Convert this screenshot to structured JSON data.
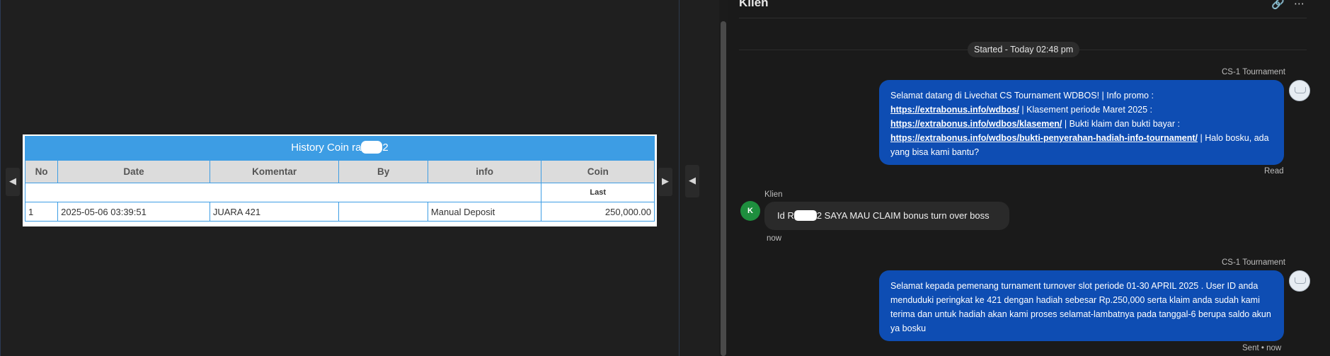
{
  "history": {
    "title_prefix": "History Coin ra",
    "title_suffix": "2",
    "columns": [
      "No",
      "Date",
      "Komentar",
      "By",
      "info",
      "Coin"
    ],
    "subheader": "Last",
    "rows": [
      {
        "no": "1",
        "date": "2025-05-06 03:39:51",
        "komentar": "JUARA 421",
        "by": "",
        "info": "Manual Deposit",
        "coin": "250,000.00"
      }
    ],
    "coin_color": "#2b8a2b",
    "accent": "#3d9de4"
  },
  "chat": {
    "title": "Klien",
    "started": "Started - Today 02:48 pm",
    "messages": [
      {
        "sender": "CS-1 Tournament",
        "parts": {
          "t1": "Selamat datang di Livechat CS Tournament WDBOS! | Info promo :",
          "l1": "https://extrabonus.info/wdbos/",
          "t2": " | Klasement periode Maret 2025 :",
          "l2": "https://extrabonus.info/wdbos/klasemen/",
          "t3": " | Bukti klaim dan bukti bayar :",
          "l3": "https://extrabonus.info/wdbos/bukti-penyerahan-hadiah-info-tournament/",
          "t4": " | Halo bosku, ada yang bisa kami bantu?"
        },
        "status": "Read"
      },
      {
        "sender": "Klien",
        "avatar": "K",
        "text_prefix": "Id R",
        "text_suffix": "2 SAYA MAU CLAIM bonus turn over boss",
        "time": "now"
      },
      {
        "sender": "CS-1 Tournament",
        "text": "Selamat kepada pemenang turnament turnover slot periode 01-30 APRIL 2025 . User ID anda menduduki peringkat ke 421 dengan hadiah sebesar Rp.250,000 serta klaim anda sudah kami terima dan untuk hadiah akan kami proses selamat-lambatnya pada tanggal-6 berupa saldo akun ya bosku",
        "status": "Sent • now"
      }
    ],
    "bubble_color": "#0e4db3"
  },
  "icons": [
    "arrow-left-icon",
    "arrow-right-icon",
    "collapse-arrow-icon",
    "link-icon",
    "more-icon"
  ]
}
